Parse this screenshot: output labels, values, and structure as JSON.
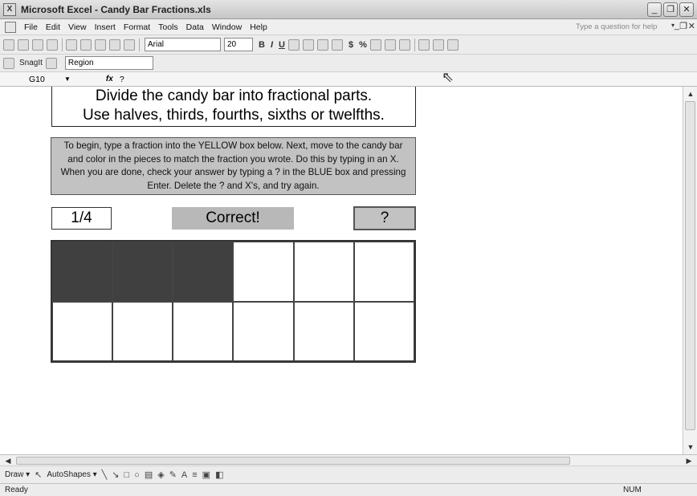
{
  "window": {
    "title": "Microsoft Excel - Candy Bar Fractions.xls",
    "app_icon": "excel-icon",
    "controls": [
      "_",
      "❐",
      "✕"
    ]
  },
  "menu": {
    "items": [
      "File",
      "Edit",
      "View",
      "Insert",
      "Format",
      "Tools",
      "Data",
      "Window",
      "Help"
    ],
    "help_placeholder": "Type a question for help",
    "doc_controls": [
      "_",
      "❐",
      "✕"
    ]
  },
  "toolbar": {
    "font": "Arial",
    "size": "20",
    "format_glyphs": [
      "B",
      "I",
      "U",
      "$",
      "%"
    ]
  },
  "snagit": {
    "label": "SnagIt",
    "mode": "Region"
  },
  "formula_bar": {
    "cell_ref": "G10",
    "fx": "fx",
    "value": "?"
  },
  "sheet": {
    "heading_line1": "Divide the candy bar into fractional parts.",
    "heading_line2": "Use halves, thirds, fourths, sixths or twelfths.",
    "instructions": "To begin, type a fraction into the YELLOW box below. Next, move to the candy bar and color in the pieces to match the fraction you wrote. Do this by typing in an X.  When you are done, check your answer by typing a ? in the BLUE box and pressing Enter. Delete the ? and X's, and try again.",
    "fraction": "1/4",
    "result": "Correct!",
    "check": "?",
    "candy_bar": {
      "rows": 2,
      "cols": 6,
      "filled": [
        [
          true,
          true,
          true,
          false,
          false,
          false
        ],
        [
          false,
          false,
          false,
          false,
          false,
          false
        ]
      ]
    }
  },
  "drawing_toolbar": {
    "draw_label": "Draw ▾",
    "autoshapes_label": "AutoShapes ▾"
  },
  "status": {
    "text": "Ready",
    "num": "NUM"
  }
}
